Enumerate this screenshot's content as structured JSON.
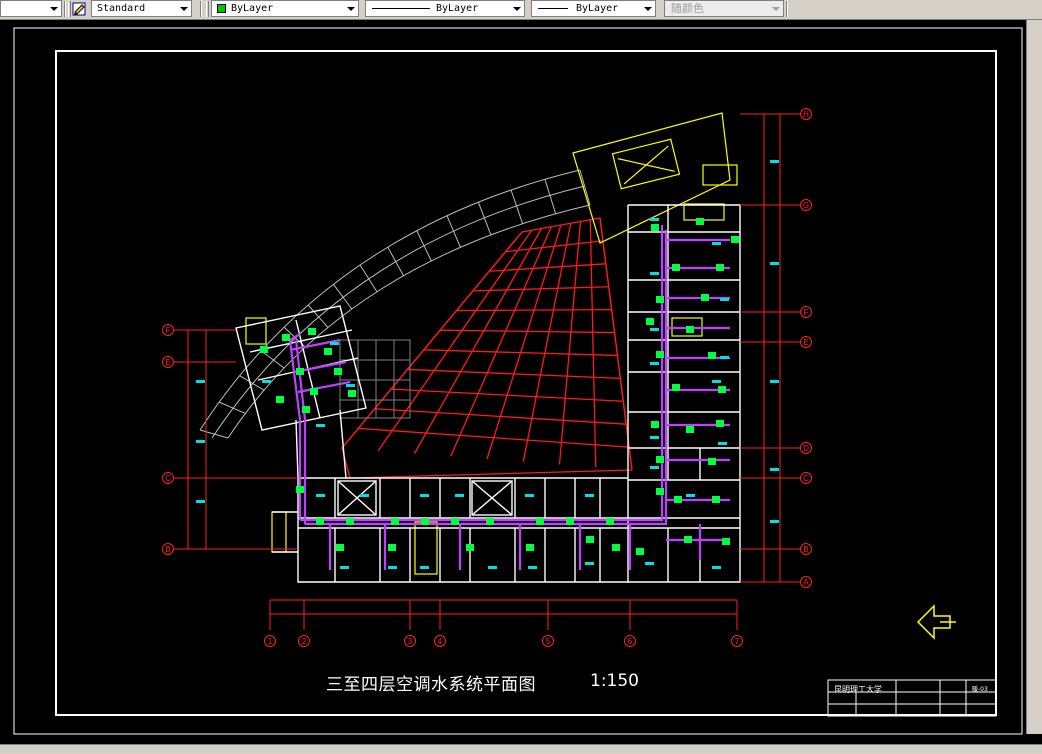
{
  "toolbar": {
    "text_style": "Standard",
    "layer_color": "ByLayer",
    "linetype": "ByLayer",
    "lineweight": "ByLayer",
    "plot_style": "随颜色"
  },
  "drawing": {
    "title": "三至四层空调水系统平面图",
    "scale": "1:150",
    "title_block": {
      "school": "昆明理工大学",
      "drawing_no": "暖-03"
    },
    "grid_letters": [
      "H",
      "G",
      "F",
      "E",
      "D",
      "C",
      "B",
      "A"
    ],
    "grid_letters_left": [
      "F",
      "E",
      "C",
      "B"
    ],
    "grid_numbers": [
      "1",
      "2",
      "3",
      "4",
      "5",
      "6",
      "7"
    ]
  },
  "colors": {
    "background": "#000000",
    "walls": "#ffffff",
    "grid_axis": "#ff2020",
    "pipes": "#c040ff",
    "fan_coils": "#00ff40",
    "labels": "#00ffff",
    "highlight": "#ffff00"
  }
}
